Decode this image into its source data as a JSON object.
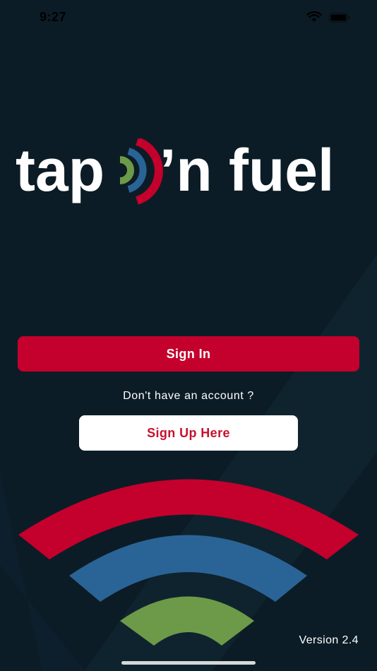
{
  "status_bar": {
    "time": "9:27",
    "wifi_icon": "wifi-icon",
    "battery_icon": "battery-icon"
  },
  "logo": {
    "left_text": "tap",
    "right_text": "’n fuel",
    "signal_icon": "nfc-signal-icon"
  },
  "actions": {
    "sign_in_label": "Sign In",
    "no_account_prompt": "Don't have an account ?",
    "sign_up_label": "Sign Up Here"
  },
  "footer": {
    "version": "Version 2.4"
  },
  "colors": {
    "background": "#0c1c26",
    "brand_red": "#c4002c",
    "brand_blue": "#2a6496",
    "brand_green": "#6d9a48",
    "white": "#ffffff"
  }
}
